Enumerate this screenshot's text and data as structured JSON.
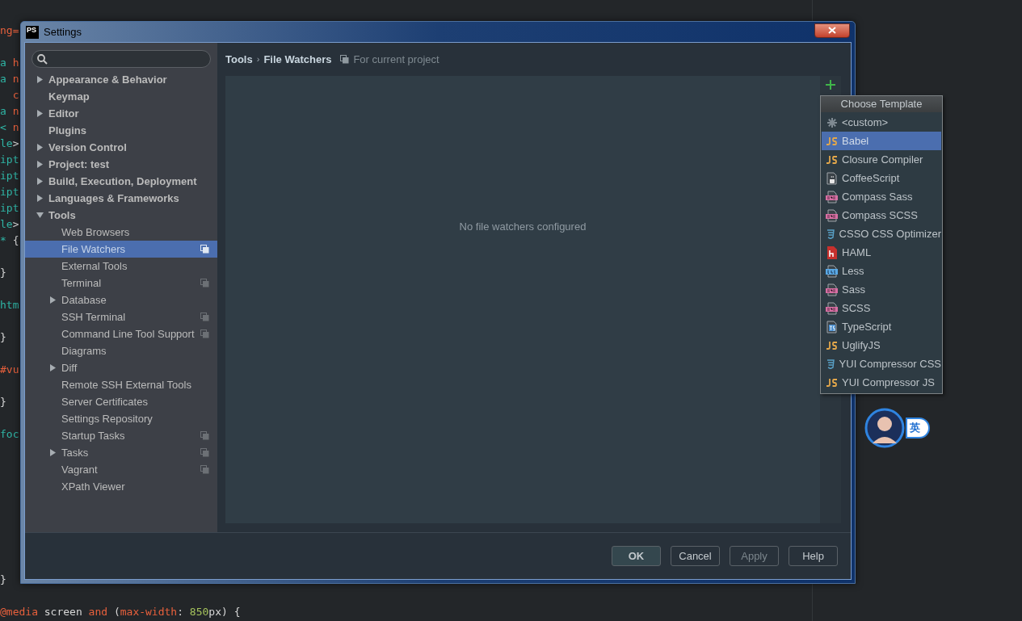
{
  "editor": {
    "lines": [
      {
        "kind": "code",
        "tokens": [
          {
            "text": "ng=",
            "kind": "keyword"
          }
        ]
      },
      {
        "kind": "blank"
      },
      {
        "kind": "code",
        "tokens": [
          {
            "text": "a ",
            "kind": "tag"
          },
          {
            "text": "h",
            "kind": "keyword"
          }
        ]
      },
      {
        "kind": "code",
        "tokens": [
          {
            "text": "a ",
            "kind": "tag"
          },
          {
            "text": "n",
            "kind": "keyword"
          }
        ]
      },
      {
        "kind": "code",
        "tokens": [
          {
            "text": "  c",
            "kind": "keyword"
          }
        ]
      },
      {
        "kind": "code",
        "tokens": [
          {
            "text": "a ",
            "kind": "tag"
          },
          {
            "text": "n",
            "kind": "keyword"
          }
        ]
      },
      {
        "kind": "code",
        "tokens": [
          {
            "text": "< ",
            "kind": "tag"
          },
          {
            "text": "n",
            "kind": "keyword"
          }
        ]
      },
      {
        "kind": "code",
        "tokens": [
          {
            "text": "le",
            "kind": "tag"
          },
          {
            "text": ">",
            "kind": "plain"
          }
        ]
      },
      {
        "kind": "code",
        "tokens": [
          {
            "text": "ipt",
            "kind": "tag"
          }
        ]
      },
      {
        "kind": "code",
        "tokens": [
          {
            "text": "ipt",
            "kind": "tag"
          }
        ]
      },
      {
        "kind": "code",
        "tokens": [
          {
            "text": "ipt",
            "kind": "tag"
          }
        ]
      },
      {
        "kind": "code",
        "tokens": [
          {
            "text": "ipt",
            "kind": "tag"
          }
        ]
      },
      {
        "kind": "code",
        "tokens": [
          {
            "text": "le",
            "kind": "tag"
          },
          {
            "text": ">",
            "kind": "plain"
          }
        ]
      },
      {
        "kind": "code",
        "tokens": [
          {
            "text": "* ",
            "kind": "tag"
          },
          {
            "text": "{",
            "kind": "plain"
          }
        ]
      },
      {
        "kind": "blank"
      },
      {
        "kind": "code",
        "tokens": [
          {
            "text": "}",
            "kind": "plain"
          }
        ]
      },
      {
        "kind": "blank"
      },
      {
        "kind": "code",
        "tokens": [
          {
            "text": "htm",
            "kind": "tag"
          }
        ]
      },
      {
        "kind": "blank"
      },
      {
        "kind": "code",
        "tokens": [
          {
            "text": "}",
            "kind": "plain"
          }
        ]
      },
      {
        "kind": "blank"
      },
      {
        "kind": "code",
        "tokens": [
          {
            "text": "#vu",
            "kind": "keyword"
          }
        ]
      },
      {
        "kind": "blank"
      },
      {
        "kind": "code",
        "tokens": [
          {
            "text": "}",
            "kind": "plain"
          }
        ]
      },
      {
        "kind": "blank"
      },
      {
        "kind": "code",
        "tokens": [
          {
            "text": "foc",
            "kind": "tag"
          }
        ]
      },
      {
        "kind": "blank"
      },
      {
        "kind": "blank"
      },
      {
        "kind": "blank"
      },
      {
        "kind": "blank"
      },
      {
        "kind": "blank"
      },
      {
        "kind": "blank"
      },
      {
        "kind": "blank"
      },
      {
        "kind": "blank"
      },
      {
        "kind": "code",
        "tokens": [
          {
            "text": "}",
            "kind": "plain"
          }
        ]
      },
      {
        "kind": "blank"
      },
      {
        "kind": "code",
        "tokens": [
          {
            "text": "@media",
            "kind": "keyword"
          },
          {
            "text": " screen ",
            "kind": "plain"
          },
          {
            "text": "and",
            "kind": "keyword"
          },
          {
            "text": " (",
            "kind": "plain"
          },
          {
            "text": "max-width",
            "kind": "keyword"
          },
          {
            "text": ": ",
            "kind": "plain"
          },
          {
            "text": "850",
            "kind": "number"
          },
          {
            "text": "px) {",
            "kind": "plain"
          }
        ]
      }
    ]
  },
  "window": {
    "title": "Settings",
    "app_badge": "PS"
  },
  "sidebar": {
    "items": [
      {
        "label": "Appearance & Behavior",
        "expanded": false,
        "selected": false,
        "project": false
      },
      {
        "label": "Keymap",
        "selected": false,
        "project": false
      },
      {
        "label": "Editor",
        "expanded": false,
        "selected": false,
        "project": false
      },
      {
        "label": "Plugins",
        "selected": false,
        "project": false
      },
      {
        "label": "Version Control",
        "expanded": false,
        "selected": false,
        "project": false
      },
      {
        "label": "Project: test",
        "expanded": false,
        "selected": false,
        "project": false
      },
      {
        "label": "Build, Execution, Deployment",
        "expanded": false,
        "selected": false,
        "project": false
      },
      {
        "label": "Languages & Frameworks",
        "expanded": false,
        "selected": false,
        "project": false
      },
      {
        "label": "Tools",
        "expanded": true,
        "selected": false,
        "project": false,
        "children": [
          {
            "label": "Web Browsers",
            "selected": false,
            "project": false
          },
          {
            "label": "File Watchers",
            "selected": true,
            "project": true
          },
          {
            "label": "External Tools",
            "selected": false,
            "project": false
          },
          {
            "label": "Terminal",
            "selected": false,
            "project": true
          },
          {
            "label": "Database",
            "expanded": false,
            "selected": false,
            "project": false
          },
          {
            "label": "SSH Terminal",
            "selected": false,
            "project": true
          },
          {
            "label": "Command Line Tool Support",
            "selected": false,
            "project": true
          },
          {
            "label": "Diagrams",
            "selected": false,
            "project": false
          },
          {
            "label": "Diff",
            "expanded": false,
            "selected": false,
            "project": false
          },
          {
            "label": "Remote SSH External Tools",
            "selected": false,
            "project": false
          },
          {
            "label": "Server Certificates",
            "selected": false,
            "project": false
          },
          {
            "label": "Settings Repository",
            "selected": false,
            "project": false
          },
          {
            "label": "Startup Tasks",
            "selected": false,
            "project": true
          },
          {
            "label": "Tasks",
            "expanded": false,
            "selected": false,
            "project": true
          },
          {
            "label": "Vagrant",
            "selected": false,
            "project": true
          },
          {
            "label": "XPath Viewer",
            "selected": false,
            "project": false
          }
        ]
      }
    ]
  },
  "breadcrumb": {
    "parent": "Tools",
    "separator": "›",
    "current": "File Watchers",
    "scope": "For current project"
  },
  "content": {
    "empty_text": "No file watchers configured"
  },
  "template_menu": {
    "title": "Choose Template",
    "items": [
      {
        "label": "<custom>",
        "kind": "asterisk",
        "selected": false
      },
      {
        "label": "Babel",
        "kind": "js",
        "selected": true
      },
      {
        "label": "Closure Compiler",
        "kind": "js",
        "selected": false
      },
      {
        "label": "CoffeeScript",
        "kind": "coffee",
        "selected": false
      },
      {
        "label": "Compass Sass",
        "kind": "sass",
        "selected": false
      },
      {
        "label": "Compass SCSS",
        "kind": "sass",
        "selected": false
      },
      {
        "label": "CSSO CSS Optimizer",
        "kind": "css",
        "selected": false
      },
      {
        "label": "HAML",
        "kind": "haml",
        "selected": false
      },
      {
        "label": "Less",
        "kind": "less",
        "selected": false
      },
      {
        "label": "Sass",
        "kind": "sass",
        "selected": false
      },
      {
        "label": "SCSS",
        "kind": "sass",
        "selected": false
      },
      {
        "label": "TypeScript",
        "kind": "ts",
        "selected": false
      },
      {
        "label": "UglifyJS",
        "kind": "js",
        "selected": false
      },
      {
        "label": "YUI Compressor CSS",
        "kind": "css",
        "selected": false
      },
      {
        "label": "YUI Compressor JS",
        "kind": "js",
        "selected": false
      }
    ]
  },
  "buttons": [
    {
      "label": "OK",
      "default": true,
      "disabled": false
    },
    {
      "label": "Cancel",
      "default": false,
      "disabled": false
    },
    {
      "label": "Apply",
      "default": false,
      "disabled": true
    },
    {
      "label": "Help",
      "default": false,
      "disabled": false
    }
  ],
  "ime_widget": {
    "label": "英"
  }
}
